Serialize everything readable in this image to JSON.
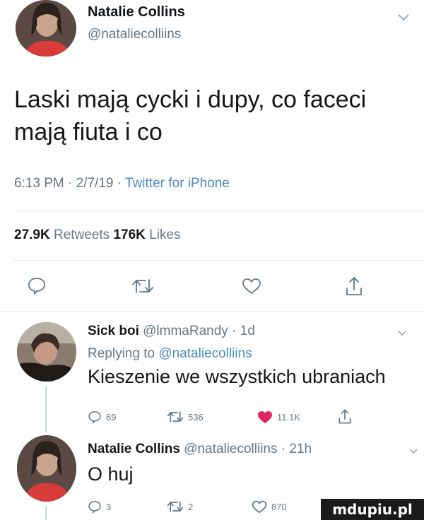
{
  "main_tweet": {
    "author_name": "Natalie Collins",
    "author_handle": "@nataliecolliins",
    "text": "Laski mają cycki i dupy, co faceci mają fiuta i co",
    "time": "6:13 PM · 2/7/19 · ",
    "client": "Twitter for iPhone",
    "retweets_count": "27.9K",
    "retweets_label": " Retweets ",
    "likes_count": "176K",
    "likes_label": " Likes",
    "icons": [
      "reply-icon",
      "retweet-icon",
      "like-icon",
      "share-icon"
    ]
  },
  "reply_1": {
    "author_name": "Sick boi",
    "author_meta": " @lmmaRandy · 1d",
    "replying_prefix": "Replying to ",
    "replying_to": "@nataliecolliins",
    "text": "Kieszenie we wszystkich ubraniach",
    "reply_count": "69",
    "retweet_count": "536",
    "like_count": "11.1K",
    "like_color": "#e0245e"
  },
  "reply_2": {
    "author_name": "Natalie Collins",
    "author_meta": " @nataliecolliins · 21h",
    "text": "O huj",
    "reply_count": "3",
    "retweet_count": "2",
    "like_count": "870"
  },
  "watermark": "mdupiu.pl"
}
